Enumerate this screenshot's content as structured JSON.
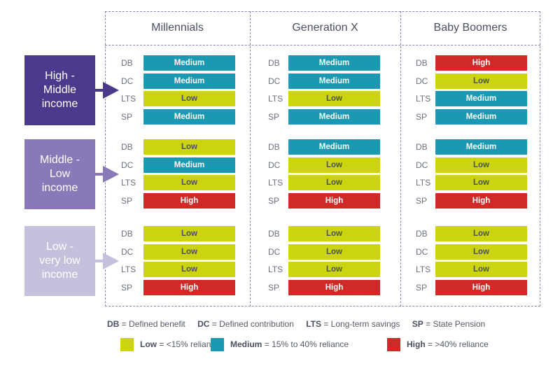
{
  "colors": {
    "Low": "#ccd40f",
    "Medium": "#1b98b2",
    "High": "#cf2a27",
    "low_text": "#4a4f5c",
    "high_income": "#4b3a8c",
    "middle_income": "#8a79b8",
    "low_income": "#c6c0dc"
  },
  "columns": [
    "Millennials",
    "Generation X",
    "Baby Boomers"
  ],
  "row_labels": [
    "DB",
    "DC",
    "LTS",
    "SP"
  ],
  "income_groups": [
    {
      "label_lines": [
        "High -",
        "Middle",
        "income"
      ],
      "color_key": "high_income"
    },
    {
      "label_lines": [
        "Middle -",
        "Low",
        "income"
      ],
      "color_key": "middle_income"
    },
    {
      "label_lines": [
        "Low -",
        "very low",
        "income"
      ],
      "color_key": "low_income"
    }
  ],
  "chart_data": {
    "type": "table",
    "title": "",
    "columns": [
      "Millennials",
      "Generation X",
      "Baby Boomers"
    ],
    "groups": [
      "High - Middle income",
      "Middle - Low income",
      "Low - very low income"
    ],
    "rows": [
      "DB",
      "DC",
      "LTS",
      "SP"
    ],
    "values": [
      [
        [
          "Medium",
          "Medium",
          "Low",
          "Medium"
        ],
        [
          "Medium",
          "Medium",
          "Low",
          "Medium"
        ],
        [
          "High",
          "Low",
          "Medium",
          "Medium"
        ]
      ],
      [
        [
          "Low",
          "Medium",
          "Low",
          "High"
        ],
        [
          "Medium",
          "Low",
          "Low",
          "High"
        ],
        [
          "Medium",
          "Low",
          "Low",
          "High"
        ]
      ],
      [
        [
          "Low",
          "Low",
          "Low",
          "High"
        ],
        [
          "Low",
          "Low",
          "Low",
          "High"
        ],
        [
          "Low",
          "Low",
          "Low",
          "High"
        ]
      ]
    ]
  },
  "legend": {
    "abbreviations": [
      {
        "key": "DB",
        "text": "= Defined benefit"
      },
      {
        "key": "DC",
        "text": "= Defined contribution"
      },
      {
        "key": "LTS",
        "text": "= Long-term savings"
      },
      {
        "key": "SP",
        "text": "= State Pension"
      }
    ],
    "levels": [
      {
        "key": "Low",
        "text": "= <15% reliance"
      },
      {
        "key": "Medium",
        "text": "= 15% to 40% reliance"
      },
      {
        "key": "High",
        "text": "= >40% reliance"
      }
    ]
  }
}
